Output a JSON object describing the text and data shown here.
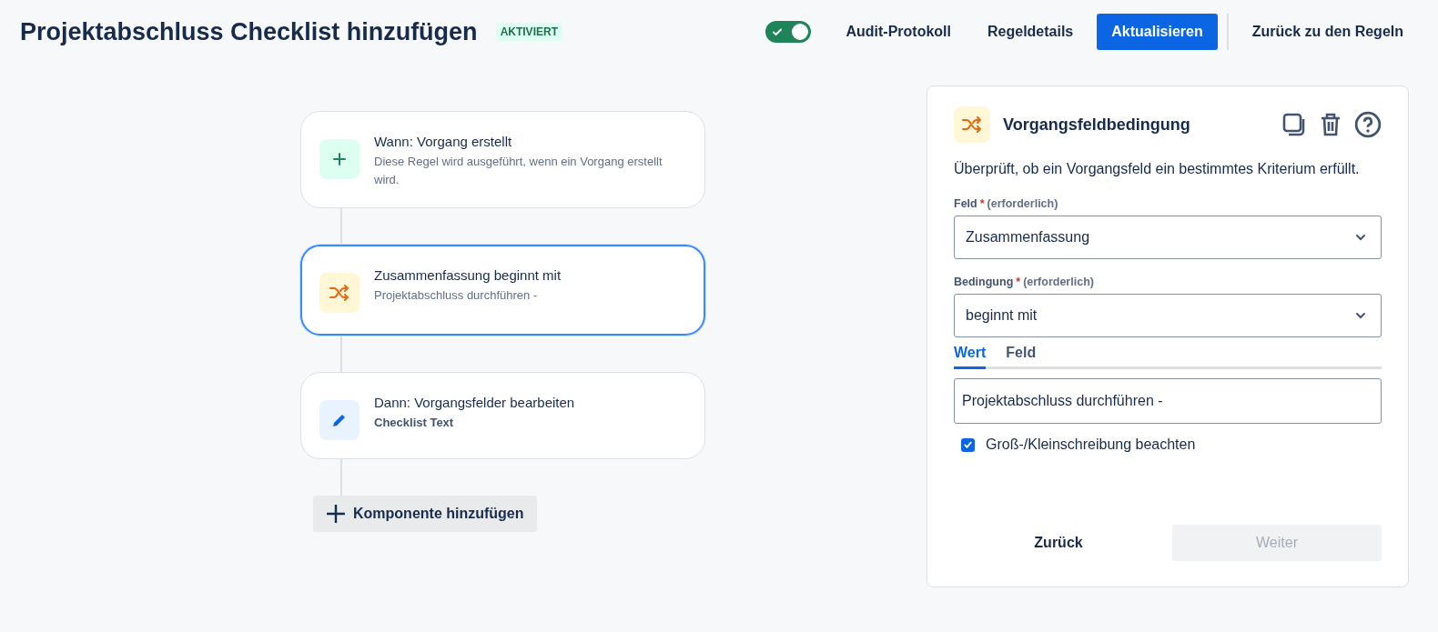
{
  "header": {
    "title": "Projektabschluss Checklist hinzufügen",
    "status_badge": "AKTIVIERT",
    "rule_enabled": true,
    "actions": [
      {
        "label": "Audit-Protokoll",
        "kind": "link"
      },
      {
        "label": "Regeldetails",
        "kind": "link"
      },
      {
        "label": "Aktualisieren",
        "kind": "primary"
      },
      {
        "label": "Zurück zu den Regeln",
        "kind": "back"
      }
    ]
  },
  "components": [
    {
      "kind": "trigger",
      "title": "Wann: Vorgang erstellt",
      "subtitle": "Diese Regel wird ausgeführt, wenn ein Vorgang erstellt wird.",
      "selected": false
    },
    {
      "kind": "condition",
      "title": "Zusammenfassung beginnt mit",
      "subtitle": "Projektabschluss durchführen -",
      "selected": true
    },
    {
      "kind": "action",
      "title": "Dann: Vorgangsfelder bearbeiten",
      "subtitle": "Checklist Text",
      "selected": false
    }
  ],
  "add_component": "Komponente hinzufügen",
  "panel": {
    "title": "Vorgangsfeldbedingung",
    "description": "Überprüft, ob ein Vorgangsfeld ein bestimmtes Kriterium erfüllt.",
    "fields": [
      {
        "label": "Feld",
        "required_mark": "*",
        "hint": "(erforderlich)",
        "value": "Zusammenfassung"
      },
      {
        "label": "Bedingung",
        "required_mark": "*",
        "hint": "(erforderlich)",
        "value": "beginnt mit"
      }
    ],
    "tabs": [
      {
        "label": "Wert",
        "selected": true
      },
      {
        "label": "Feld",
        "selected": false
      }
    ],
    "value_input": "Projektabschluss durchführen -",
    "case_sensitive": {
      "label": "Groß-/Kleinschreibung beachten",
      "checked": true
    },
    "buttons": [
      {
        "label": "Zurück",
        "disabled": false
      },
      {
        "label": "Weiter",
        "disabled": true
      }
    ]
  }
}
